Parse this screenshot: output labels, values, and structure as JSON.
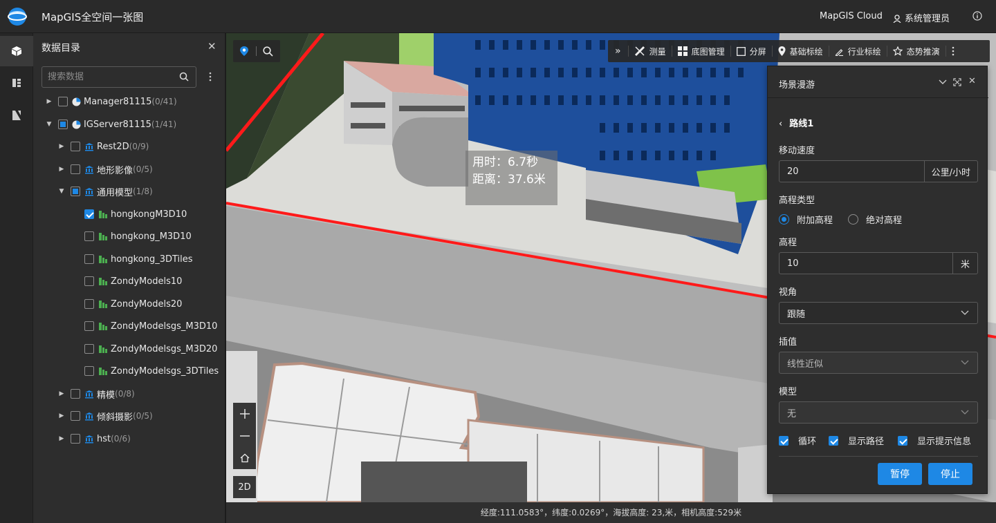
{
  "app": {
    "title": "MapGIS全空间一张图",
    "cloud": "MapGIS Cloud",
    "user": "系统管理员"
  },
  "catalog": {
    "title": "数据目录",
    "search_placeholder": "搜索数据",
    "items": [
      {
        "label": "Manager81115",
        "count": "(0/41)"
      },
      {
        "label": "IGServer81115",
        "count": "(1/41)"
      },
      {
        "label": "Rest2D",
        "count": "(0/9)"
      },
      {
        "label": "地形影像",
        "count": "(0/5)"
      },
      {
        "label": "通用模型",
        "count": "(1/8)"
      },
      {
        "label": "hongkongM3D10",
        "count": ""
      },
      {
        "label": "hongkong_M3D10",
        "count": ""
      },
      {
        "label": "hongkong_3DTiles",
        "count": ""
      },
      {
        "label": "ZondyModels10",
        "count": ""
      },
      {
        "label": "ZondyModels20",
        "count": ""
      },
      {
        "label": "ZondyModelsgs_M3D10",
        "count": ""
      },
      {
        "label": "ZondyModelsgs_M3D20",
        "count": ""
      },
      {
        "label": "ZondyModelsgs_3DTiles",
        "count": ""
      },
      {
        "label": "精模",
        "count": "(0/8)"
      },
      {
        "label": "倾斜摄影",
        "count": "(0/5)"
      },
      {
        "label": "hst",
        "count": "(0/6)"
      }
    ]
  },
  "toolbar": {
    "items": [
      {
        "label": "测量",
        "icon": "ruler-icon"
      },
      {
        "label": "底图管理",
        "icon": "grid-icon"
      },
      {
        "label": "分屏",
        "icon": "split-icon"
      },
      {
        "label": "基础标绘",
        "icon": "pin-icon"
      },
      {
        "label": "行业标绘",
        "icon": "pen-icon"
      },
      {
        "label": "态势推演",
        "icon": "star-icon"
      }
    ]
  },
  "map": {
    "tooltip": {
      "time": "用时：6.7秒",
      "distance": "距离：37.6米"
    },
    "mode_2d": "2D",
    "status": "经度:111.0583°，纬度:0.0269°，海拔高度: 23,米，相机高度:529米"
  },
  "roam": {
    "title": "场景漫游",
    "route": "路线1",
    "speed_label": "移动速度",
    "speed_value": "20",
    "speed_unit": "公里/小时",
    "height_type_label": "高程类型",
    "opt_relative": "附加高程",
    "opt_absolute": "绝对高程",
    "height_label": "高程",
    "height_value": "10",
    "height_unit": "米",
    "view_label": "视角",
    "view_value": "跟随",
    "interp_label": "插值",
    "interp_value": "线性近似",
    "model_label": "模型",
    "model_value": "无",
    "loop": "循环",
    "show_path": "显示路径",
    "show_tip": "显示提示信息",
    "pause": "暂停",
    "stop": "停止"
  }
}
